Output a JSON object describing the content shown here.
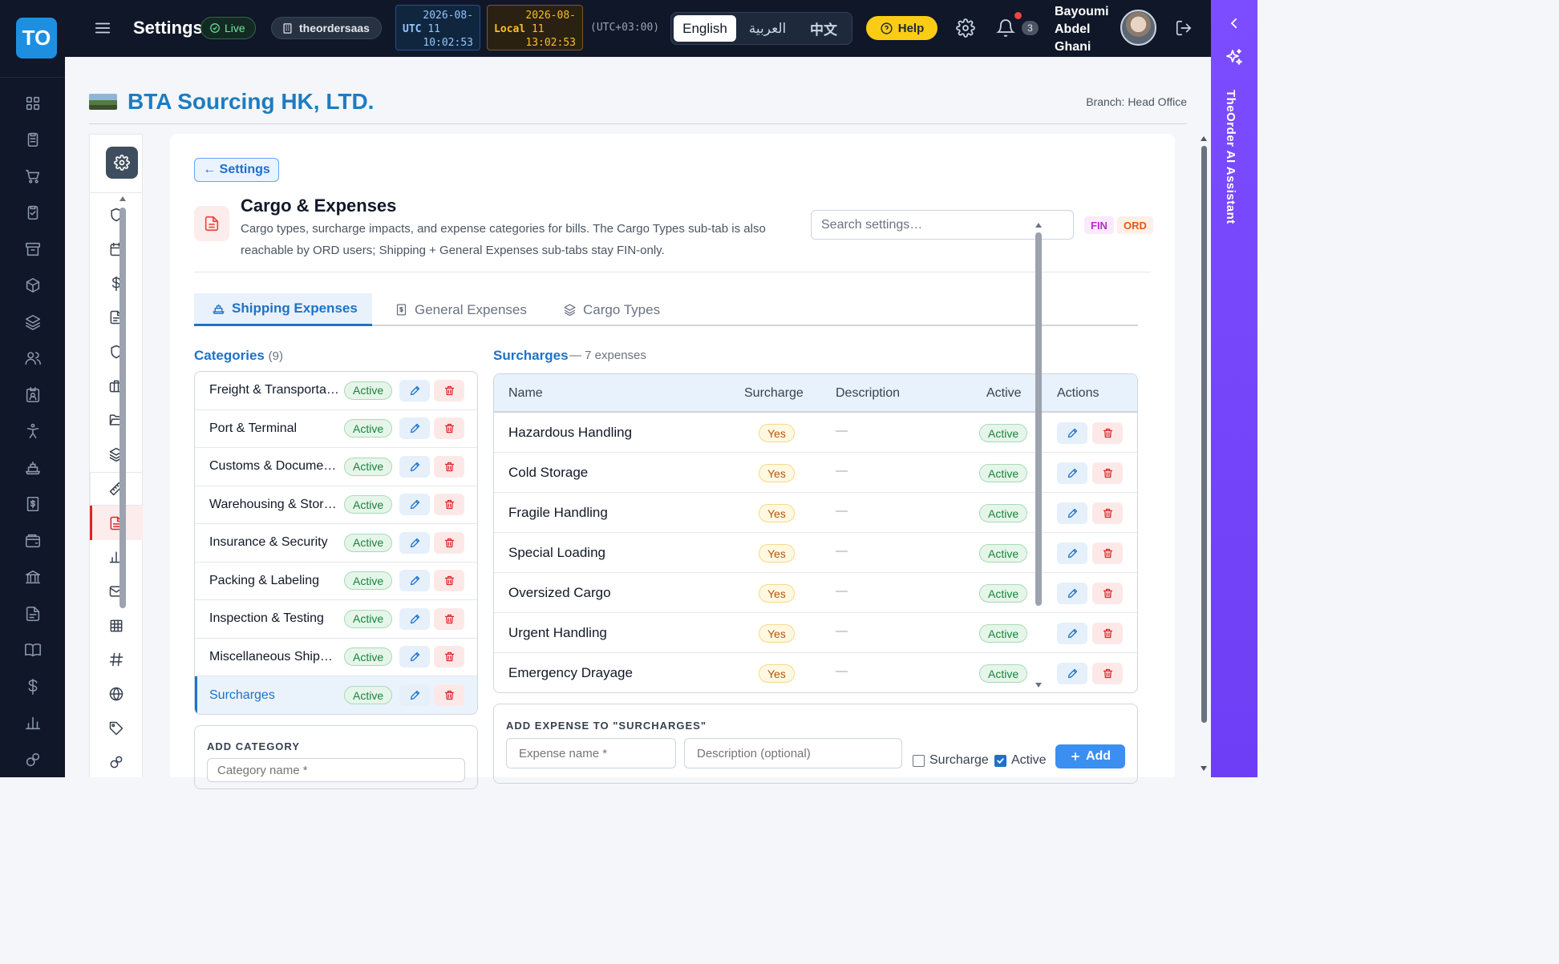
{
  "app": {
    "logo_text": "TO",
    "rail_icons": [
      "dashboard-icon",
      "clipboard-icon",
      "cart-icon",
      "checklist-icon",
      "archive-icon",
      "box-icon",
      "layers-icon",
      "users-icon",
      "id-badge-icon",
      "accessibility-icon",
      "ship-icon",
      "receipt-icon",
      "wallet-icon",
      "bank-icon",
      "document-icon",
      "book-icon",
      "dollar-icon",
      "bar-chart-icon",
      "network-icon"
    ]
  },
  "topbar": {
    "title": "Settings",
    "live_label": "Live",
    "tenant": "theordersaas",
    "clock_utc": {
      "tag": "UTC",
      "date_line1": "2026-08-",
      "date_line2": "11",
      "time": "10:02:53"
    },
    "clock_local": {
      "tag": "Local",
      "date_line1": "2026-08-",
      "date_line2": "11",
      "time": "13:02:53"
    },
    "timezone": "(UTC+03:00)",
    "languages": [
      "English",
      "العربية",
      "中文"
    ],
    "active_language": "English",
    "help_label": "Help",
    "notification_count": "3",
    "user_name_lines": [
      "Bayoumi",
      "Abdel",
      "Ghani"
    ]
  },
  "ai_panel": {
    "label": "TheOrder AI Assistant"
  },
  "company": {
    "name": "BTA Sourcing HK, LTD.",
    "branch": "Branch: Head Office"
  },
  "settings_nav": {
    "items": [
      "shield-icon",
      "calendar-icon",
      "dollar-icon",
      "document-icon",
      "shield-icon",
      "briefcase-icon",
      "folder-open-icon",
      "layers-icon",
      "ruler-icon",
      "file-text-icon",
      "bar-chart-icon",
      "mail-icon",
      "grid-icon",
      "hash-icon",
      "globe-icon",
      "tag-icon",
      "network-icon"
    ],
    "active_index": 9
  },
  "page": {
    "back_label": "← Settings",
    "title": "Cargo & Expenses",
    "description": "Cargo types, surcharge impacts, and expense categories for bills. The Cargo Types sub-tab is also reachable by ORD users; Shipping + General Expenses sub-tabs stay FIN-only.",
    "search_placeholder": "Search settings…",
    "badges": [
      "FIN",
      "ORD"
    ]
  },
  "tabs": [
    {
      "label": "Shipping Expenses",
      "icon": "ship-icon",
      "active": true
    },
    {
      "label": "General Expenses",
      "icon": "receipt-icon",
      "active": false
    },
    {
      "label": "Cargo Types",
      "icon": "layers-icon",
      "active": false
    }
  ],
  "categories": {
    "title": "Categories",
    "count": "(9)",
    "items": [
      {
        "name": "Freight & Transportation",
        "status": "Active"
      },
      {
        "name": "Port & Terminal",
        "status": "Active"
      },
      {
        "name": "Customs & Documentation",
        "status": "Active"
      },
      {
        "name": "Warehousing & Storage",
        "status": "Active"
      },
      {
        "name": "Insurance & Security",
        "status": "Active"
      },
      {
        "name": "Packing & Labeling",
        "status": "Active"
      },
      {
        "name": "Inspection & Testing",
        "status": "Active"
      },
      {
        "name": "Miscellaneous Shipping",
        "status": "Active"
      },
      {
        "name": "Surcharges",
        "status": "Active"
      }
    ],
    "selected_index": 8,
    "add_label": "ADD CATEGORY",
    "add_placeholder": "Category name *"
  },
  "surcharges": {
    "title": "Surcharges",
    "subtitle": "— 7 expenses",
    "columns": [
      "Name",
      "Surcharge",
      "Description",
      "Active",
      "Actions"
    ],
    "rows": [
      {
        "name": "Hazardous Handling",
        "surcharge": "Yes",
        "description": "—",
        "active": "Active"
      },
      {
        "name": "Cold Storage",
        "surcharge": "Yes",
        "description": "—",
        "active": "Active"
      },
      {
        "name": "Fragile Handling",
        "surcharge": "Yes",
        "description": "—",
        "active": "Active"
      },
      {
        "name": "Special Loading",
        "surcharge": "Yes",
        "description": "—",
        "active": "Active"
      },
      {
        "name": "Oversized Cargo",
        "surcharge": "Yes",
        "description": "—",
        "active": "Active"
      },
      {
        "name": "Urgent Handling",
        "surcharge": "Yes",
        "description": "—",
        "active": "Active"
      },
      {
        "name": "Emergency Drayage",
        "surcharge": "Yes",
        "description": "—",
        "active": "Active"
      }
    ]
  },
  "add_expense": {
    "label": "ADD EXPENSE TO \"SURCHARGES\"",
    "name_placeholder": "Expense name *",
    "desc_placeholder": "Description (optional)",
    "surcharge_label": "Surcharge",
    "surcharge_checked": false,
    "active_label": "Active",
    "active_checked": true,
    "add_label": "Add"
  },
  "colors": {
    "accent": "#1d72c8",
    "danger": "#dc2626",
    "success": "#16843a",
    "ai": "#7c4dff",
    "help": "#facc15"
  }
}
